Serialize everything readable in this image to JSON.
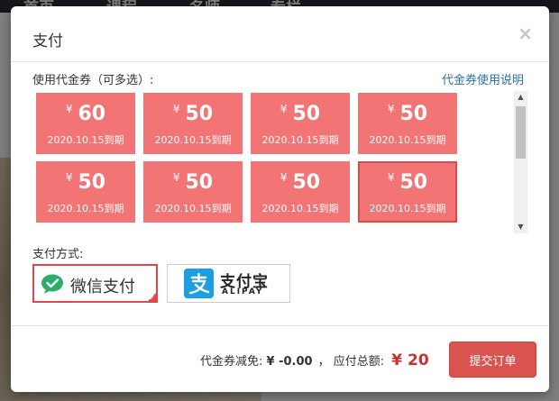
{
  "background": {
    "nav": [
      "首页",
      "课程",
      "名师",
      "专栏"
    ]
  },
  "modal": {
    "title": "支付",
    "close": "×"
  },
  "coupons": {
    "label": "使用代金券（可多选）:",
    "help_link": "代金券使用说明",
    "currency": "¥",
    "items": [
      {
        "value": "60",
        "expiry": "2020.10.15到期",
        "selected": false
      },
      {
        "value": "50",
        "expiry": "2020.10.15到期",
        "selected": false
      },
      {
        "value": "50",
        "expiry": "2020.10.15到期",
        "selected": false
      },
      {
        "value": "50",
        "expiry": "2020.10.15到期",
        "selected": false
      },
      {
        "value": "50",
        "expiry": "2020.10.15到期",
        "selected": false
      },
      {
        "value": "50",
        "expiry": "2020.10.15到期",
        "selected": false
      },
      {
        "value": "50",
        "expiry": "2020.10.15到期",
        "selected": false
      },
      {
        "value": "50",
        "expiry": "2020.10.15到期",
        "selected": true
      }
    ]
  },
  "payment": {
    "label": "支付方式:",
    "wechat": "微信支付",
    "alipay_cn": "支付宝",
    "alipay_en": "ALIPAY"
  },
  "footer": {
    "discount_label": "代金券减免:",
    "discount_value": "¥ -0.00",
    "separator": "，",
    "total_label": "应付总额:",
    "total_value": "¥ 20",
    "submit": "提交订单"
  },
  "colors": {
    "coupon": "#f27474",
    "accent": "#d9534f",
    "link": "#2a6fa8",
    "wechat": "#2aae67",
    "alipay": "#1b9fe0"
  }
}
